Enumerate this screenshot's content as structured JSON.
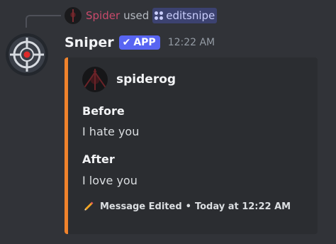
{
  "interaction": {
    "invoker_name": "Spider",
    "verb": "used",
    "command": "editsnipe"
  },
  "message": {
    "author": "Sniper",
    "badge": "APP",
    "timestamp": "12:22 AM"
  },
  "embed": {
    "accent_color": "#f0832c",
    "author_name": "spiderog",
    "fields": [
      {
        "name": "Before",
        "value": "I hate you"
      },
      {
        "name": "After",
        "value": "I love you"
      }
    ],
    "footer": {
      "icon": "pencil-icon",
      "text": "Message Edited",
      "separator": "•",
      "time": "Today at 12:22 AM"
    }
  },
  "colors": {
    "background": "#313338",
    "embed_background": "#2b2d31",
    "badge": "#5865f2",
    "invoker": "#c94a6b",
    "command_chip": "#3c4270"
  }
}
